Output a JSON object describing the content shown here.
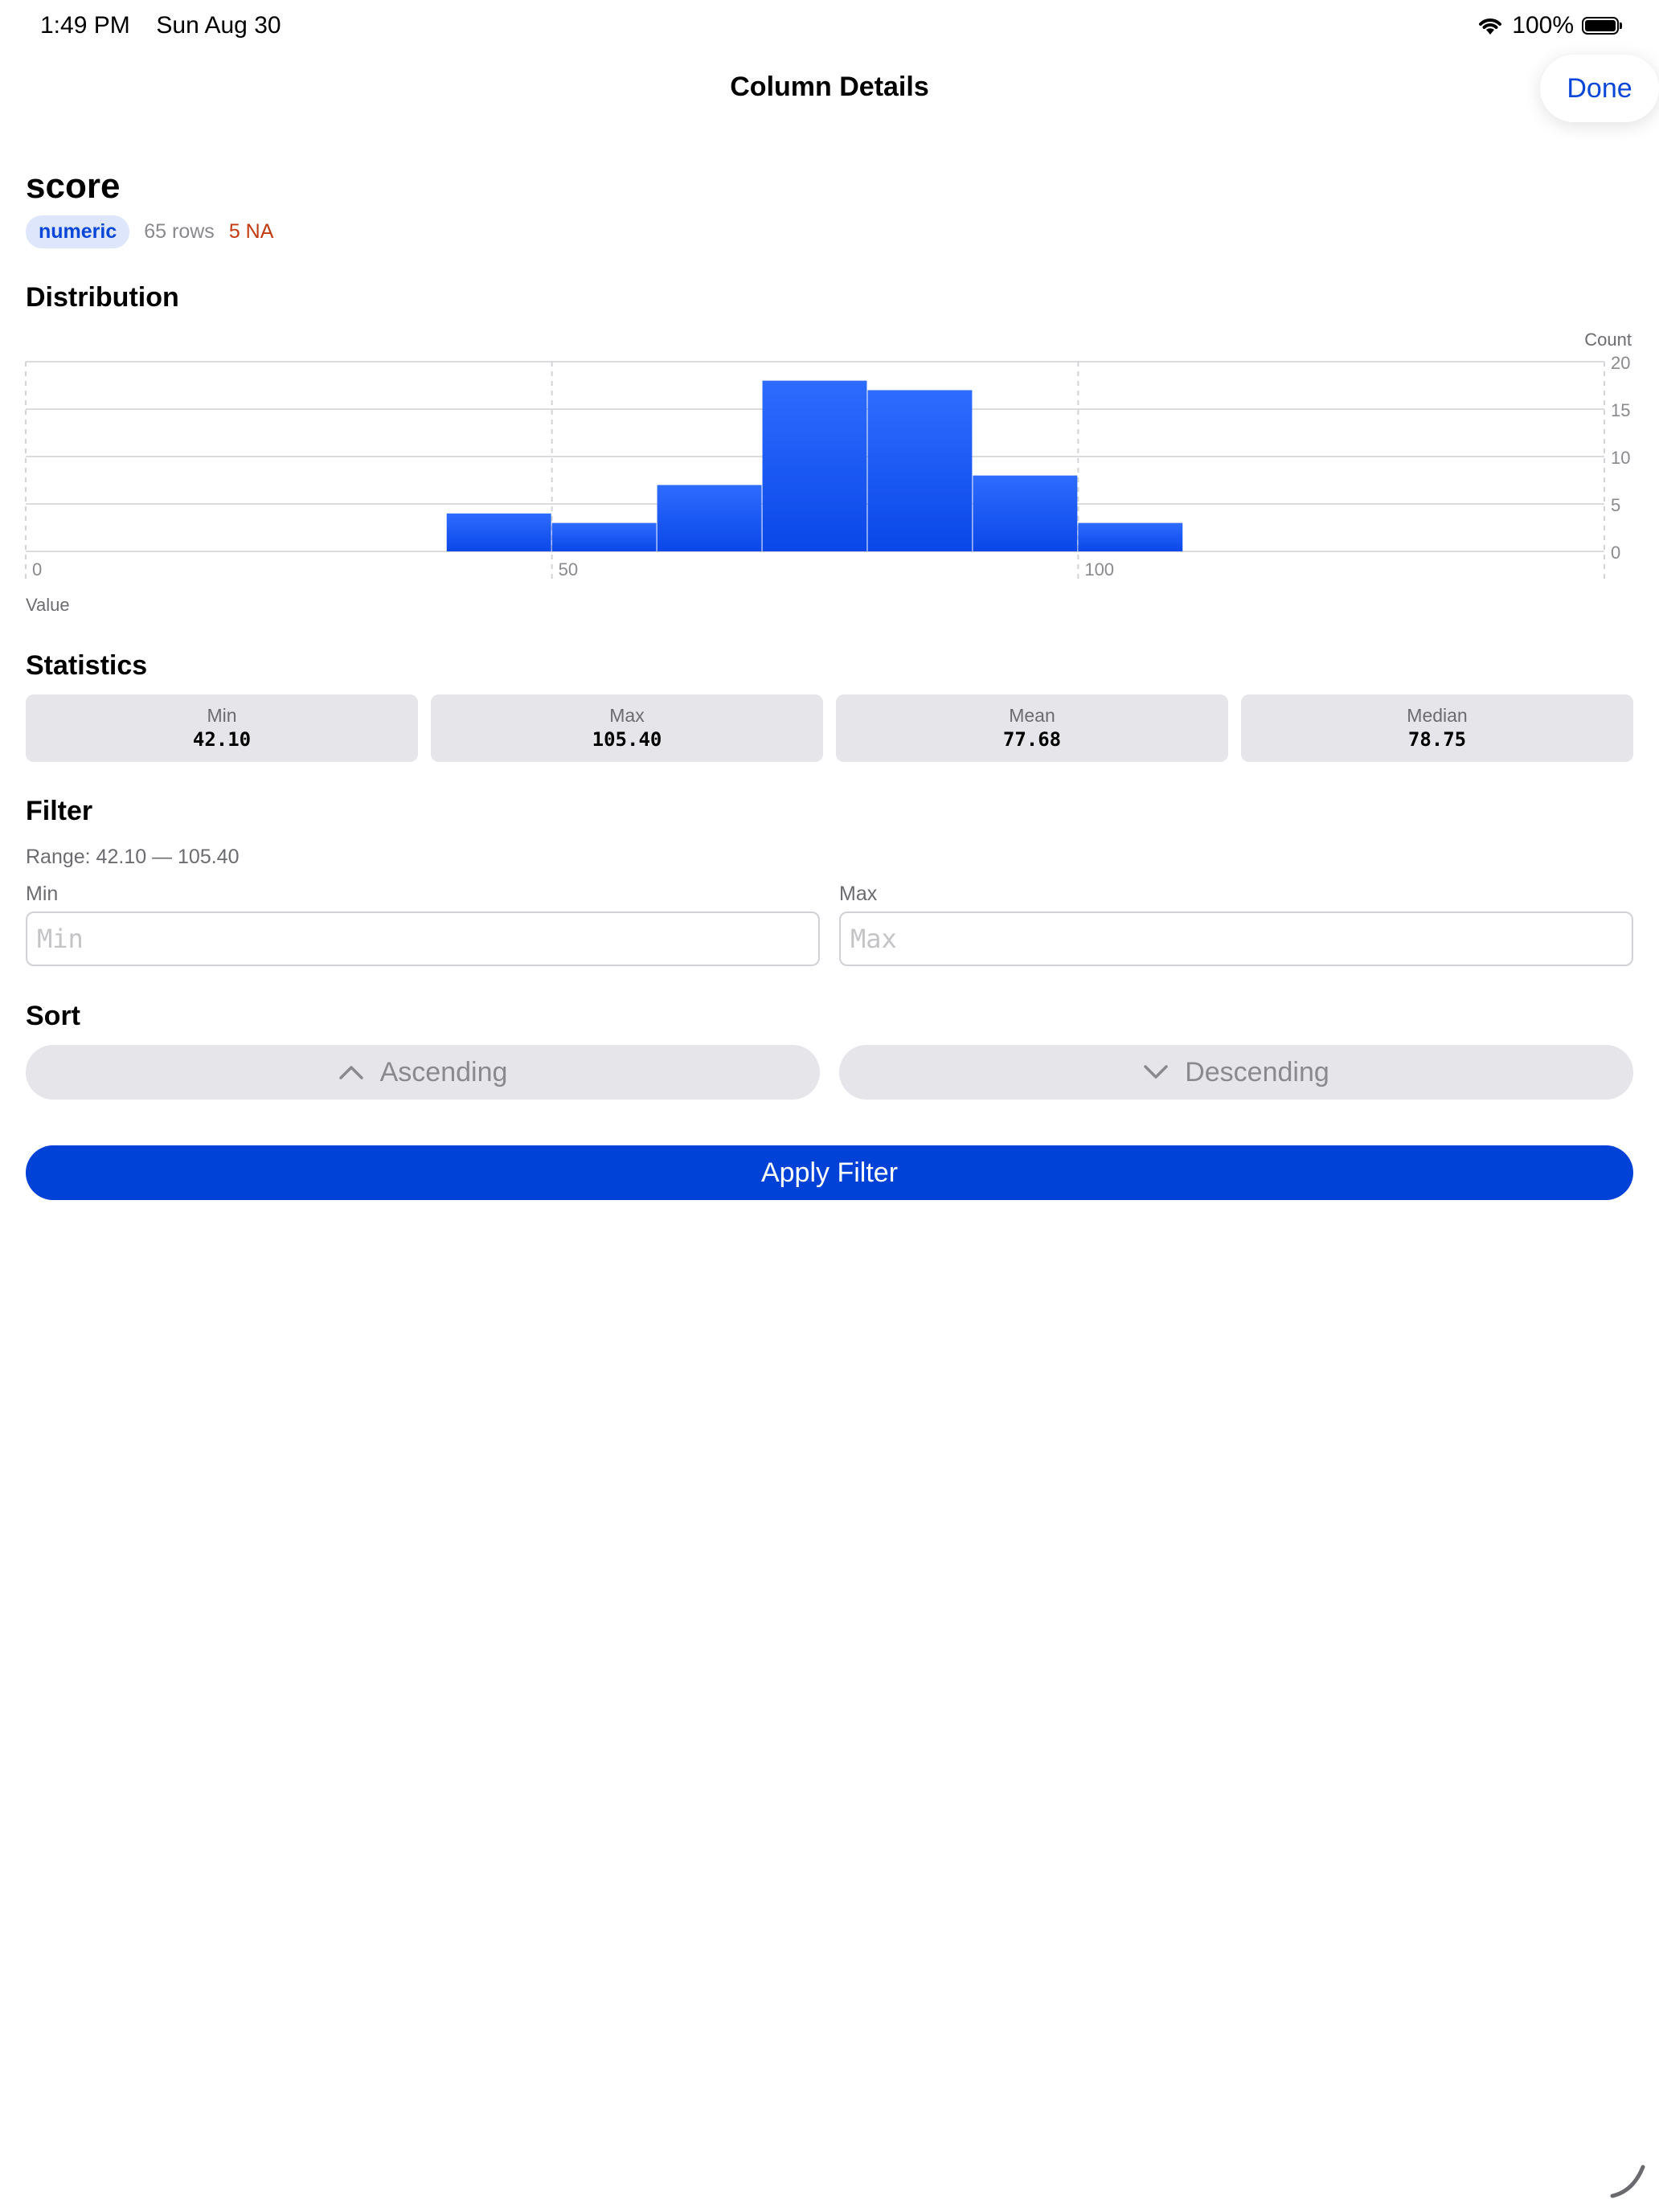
{
  "status_bar": {
    "time": "1:49 PM",
    "date": "Sun Aug 30",
    "battery": "100%"
  },
  "nav": {
    "title": "Column Details",
    "done_label": "Done"
  },
  "column": {
    "name": "score",
    "type_badge": "numeric",
    "rows": "65 rows",
    "na": "5 NA"
  },
  "sections": {
    "distribution": "Distribution",
    "statistics": "Statistics",
    "filter": "Filter",
    "sort": "Sort"
  },
  "chart_data": {
    "type": "bar",
    "bins": [
      {
        "x0": 40,
        "x1": 50,
        "count": 4
      },
      {
        "x0": 50,
        "x1": 60,
        "count": 3
      },
      {
        "x0": 60,
        "x1": 70,
        "count": 7
      },
      {
        "x0": 70,
        "x1": 80,
        "count": 18
      },
      {
        "x0": 80,
        "x1": 90,
        "count": 17
      },
      {
        "x0": 90,
        "x1": 100,
        "count": 8
      },
      {
        "x0": 100,
        "x1": 110,
        "count": 3
      }
    ],
    "xlabel": "Value",
    "ylabel": "Count",
    "xlim": [
      0,
      150
    ],
    "ylim": [
      0,
      20
    ],
    "xticks": [
      0,
      50,
      100
    ],
    "yticks": [
      0,
      5,
      10,
      15,
      20
    ],
    "grid": true,
    "bar_color": "#0a47e8"
  },
  "stats": [
    {
      "label": "Min",
      "value": "42.10"
    },
    {
      "label": "Max",
      "value": "105.40"
    },
    {
      "label": "Mean",
      "value": "77.68"
    },
    {
      "label": "Median",
      "value": "78.75"
    }
  ],
  "filter": {
    "range_text": "Range: 42.10 — 105.40",
    "min_label": "Min",
    "max_label": "Max",
    "min_placeholder": "Min",
    "max_placeholder": "Max",
    "min_value": "",
    "max_value": ""
  },
  "sort": {
    "ascending_label": "Ascending",
    "descending_label": "Descending"
  },
  "apply_label": "Apply Filter",
  "colors": {
    "accent": "#0041d8",
    "na": "#c23a10",
    "badge_bg": "#dde6fb"
  }
}
